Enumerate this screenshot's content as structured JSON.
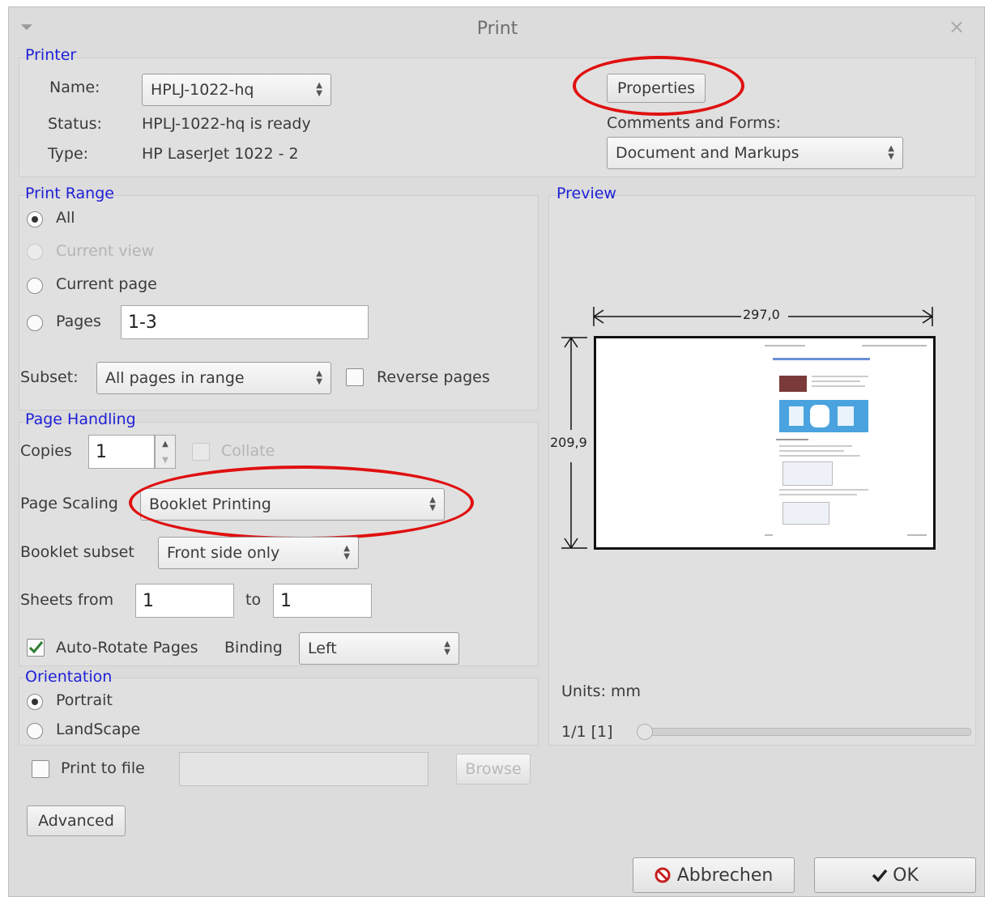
{
  "window": {
    "title": "Print",
    "menu_glyph": "⏷",
    "close_glyph": "×"
  },
  "printer": {
    "group_label": "Printer",
    "name_label": "Name:",
    "name_value": "HPLJ-1022-hq",
    "status_label": "Status:",
    "status_value": "HPLJ-1022-hq is ready",
    "type_label": "Type:",
    "type_value": "HP LaserJet 1022 -  2",
    "properties_button": "Properties",
    "comments_label": "Comments and Forms:",
    "comments_value": "Document and Markups"
  },
  "print_range": {
    "group_label": "Print Range",
    "all": "All",
    "current_view": "Current view",
    "current_page": "Current page",
    "pages": "Pages",
    "pages_value": "1-3",
    "subset_label": "Subset:",
    "subset_value": "All pages in range",
    "reverse_pages": "Reverse pages",
    "selected": "All"
  },
  "page_handling": {
    "group_label": "Page Handling",
    "copies_label": "Copies",
    "copies_value": "1",
    "collate": "Collate",
    "scaling_label": "Page Scaling",
    "scaling_value": "Booklet Printing",
    "booklet_subset_label": "Booklet subset",
    "booklet_subset_value": "Front side only",
    "sheets_from_label": "Sheets from",
    "sheets_from_value": "1",
    "to_label": "to",
    "sheets_to_value": "1",
    "auto_rotate": "Auto-Rotate Pages",
    "auto_rotate_checked": true,
    "binding_label": "Binding",
    "binding_value": "Left"
  },
  "orientation": {
    "group_label": "Orientation",
    "portrait": "Portrait",
    "landscape": "LandScape",
    "selected": "Portrait"
  },
  "print_to_file": {
    "label": "Print to file",
    "browse_button": "Browse",
    "path_value": ""
  },
  "advanced_button": "Advanced",
  "preview": {
    "group_label": "Preview",
    "width_dim": "297,0",
    "height_dim": "209,9",
    "units_label": "Units: mm",
    "page_indicator": "1/1  [1]",
    "slider_value": 0
  },
  "footer": {
    "cancel_button": "Abbrechen",
    "ok_button": "OK",
    "cancel_icon": "no-entry",
    "ok_icon": "checkmark"
  },
  "annotation_color": "#e01010"
}
